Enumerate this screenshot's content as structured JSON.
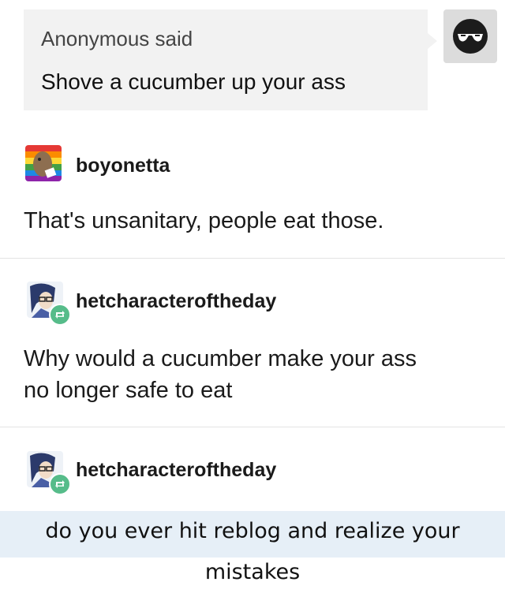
{
  "ask": {
    "asker": "Anonymous said",
    "question": "Shove a cucumber up your ass"
  },
  "posts": [
    {
      "username": "boyonetta",
      "text_lines": [
        "That's unsanitary, people eat those."
      ]
    },
    {
      "username": "hetcharacteroftheday",
      "text_lines": [
        "Why would a cucumber make your ass",
        "no longer safe to eat"
      ]
    },
    {
      "username": "hetcharacteroftheday",
      "text_lines": []
    }
  ],
  "caption": "do you ever hit reblog and realize your mistakes",
  "colors": {
    "reblog_badge": "#56bc8a",
    "caption_bg": "#e6eff7",
    "ask_bg": "#f2f2f2"
  },
  "icons": {
    "anon": "sunglasses-icon",
    "reblog": "reblog-icon"
  }
}
